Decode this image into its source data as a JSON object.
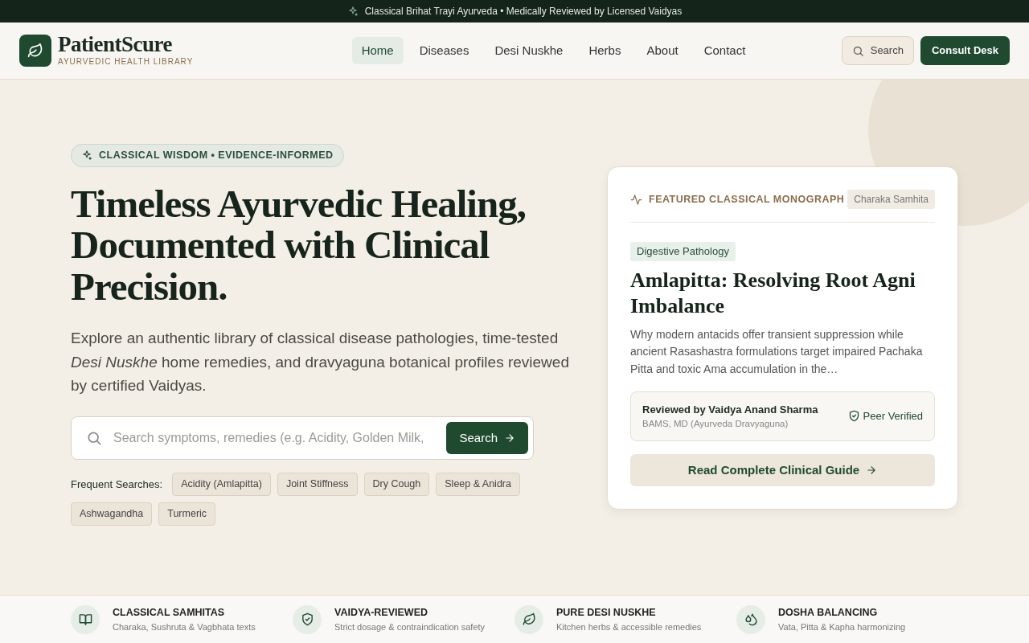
{
  "announcement": {
    "text": "Classical Brihat Trayi Ayurveda • Medically Reviewed by Licensed Vaidyas"
  },
  "brand": {
    "name": "PatientScure",
    "tagline": "AYURVEDIC HEALTH LIBRARY"
  },
  "nav": [
    {
      "label": "Home",
      "selected": true
    },
    {
      "label": "Diseases",
      "selected": false
    },
    {
      "label": "Desi Nuskhe",
      "selected": false
    },
    {
      "label": "Herbs",
      "selected": false
    },
    {
      "label": "About",
      "selected": false
    },
    {
      "label": "Contact",
      "selected": false
    }
  ],
  "header_search": {
    "label": "Search"
  },
  "consult_button": {
    "label": "Consult Desk"
  },
  "hero": {
    "eyebrow": "CLASSICAL WISDOM • EVIDENCE-INFORMED",
    "title": "Timeless Ayurvedic Healing, Documented with Clinical Precision.",
    "lead": "Explore an authentic library of classical disease pathologies, time-tested *Desi Nuskhe* home remedies, and dravyaguna botanical profiles reviewed by certified Vaidyas.",
    "search": {
      "placeholder": "Search symptoms, remedies (e.g. Acidity, Golden Milk,",
      "button": "Search"
    },
    "frequent_label": "Frequent Searches:",
    "frequent": [
      "Acidity (Amlapitta)",
      "Joint Stiffness",
      "Dry Cough",
      "Sleep & Anidra",
      "Ashwagandha",
      "Turmeric"
    ]
  },
  "featured": {
    "eyebrow": "FEATURED CLASSICAL MONOGRAPH",
    "source": "Charaka Samhita",
    "category": "Digestive Pathology",
    "title": "Amlapitta: Resolving Root Agni Imbalance",
    "summary": "Why modern antacids offer transient suppression while ancient Rasashastra formulations target impaired Pachaka Pitta and toxic Ama accumulation in the…",
    "reviewer": "Reviewed by Vaidya Anand Sharma",
    "credentials": "BAMS, MD (Ayurveda Dravyaguna)",
    "verification": "Peer Verified",
    "cta": "Read Complete Clinical Guide"
  },
  "features": [
    {
      "kind": "book",
      "title": "CLASSICAL SAMHITAS",
      "text": "Charaka, Sushruta & Vagbhata texts"
    },
    {
      "kind": "shield",
      "title": "VAIDYA-REVIEWED",
      "text": "Strict dosage & contraindication safety"
    },
    {
      "kind": "leaf",
      "title": "PURE DESI NUSKHE",
      "text": "Kitchen herbs & accessible remedies"
    },
    {
      "kind": "drops",
      "title": "DOSHA BALANCING",
      "text": "Vata, Pitta & Kapha harmonizing"
    }
  ]
}
